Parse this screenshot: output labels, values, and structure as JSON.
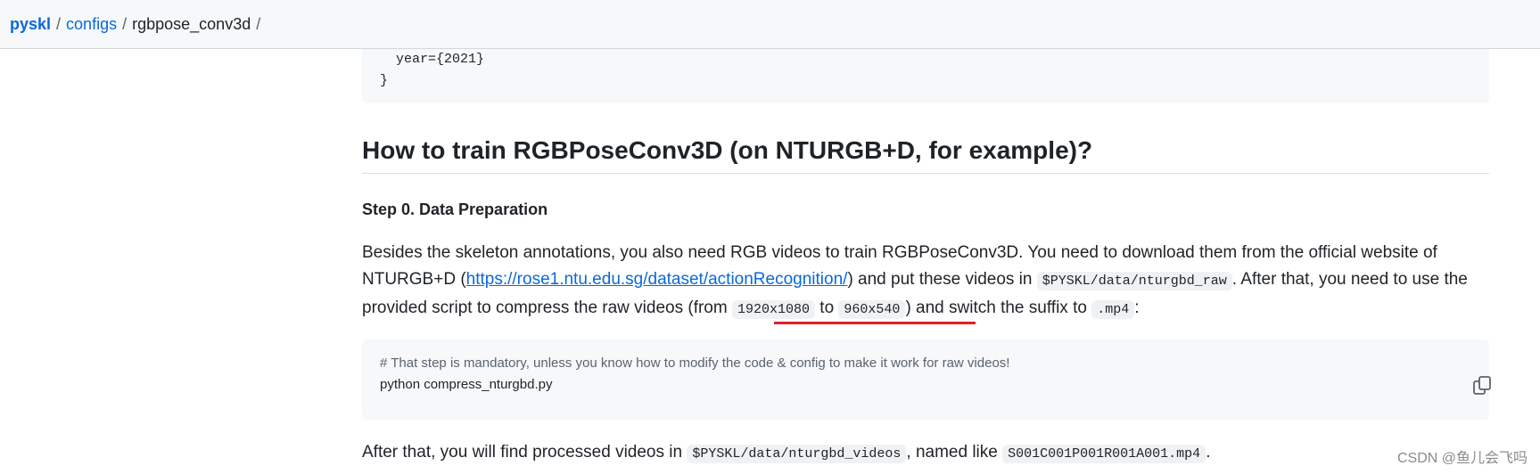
{
  "breadcrumb": {
    "repo": "pyskl",
    "folder": "configs",
    "current": "rgbpose_conv3d",
    "separator": "/"
  },
  "top_code": {
    "line1": "  year={2021}",
    "line2": "}"
  },
  "heading": "How to train RGBPoseConv3D (on NTURGB+D, for example)?",
  "step0": {
    "title": "Step 0. Data Preparation",
    "p1_text1": "Besides the skeleton annotations, you also need RGB videos to train RGBPoseConv3D. You need to download them from the official website of NTURGB+D (",
    "link": "https://rose1.ntu.edu.sg/dataset/actionRecognition/",
    "p1_text2": ") and put these videos in ",
    "path_raw": "$PYSKL/data/nturgbd_raw",
    "p1_text3": ". After that, you need to use the provided script to compress the raw videos (from ",
    "res_from": "1920x1080",
    "to_word": " to ",
    "res_to": "960x540",
    "p1_text4": ") and switch the suffix to ",
    "suffix": ".mp4",
    "p1_text5": ":"
  },
  "code": {
    "comment": "# That step is mandatory, unless you know how to modify the code & config to make it work for raw videos!",
    "command": "python compress_nturgbd.py"
  },
  "after": {
    "text1": "After that, you will find processed videos in ",
    "path_videos": "$PYSKL/data/nturgbd_videos",
    "text2": ", named like ",
    "example_name": "S001C001P001R001A001.mp4",
    "text3": "."
  },
  "watermark": "CSDN @鱼儿会飞吗",
  "colors": {
    "link": "#0969da",
    "annotation_underline": "#e0202b",
    "code_bg": "#f6f8fa"
  }
}
